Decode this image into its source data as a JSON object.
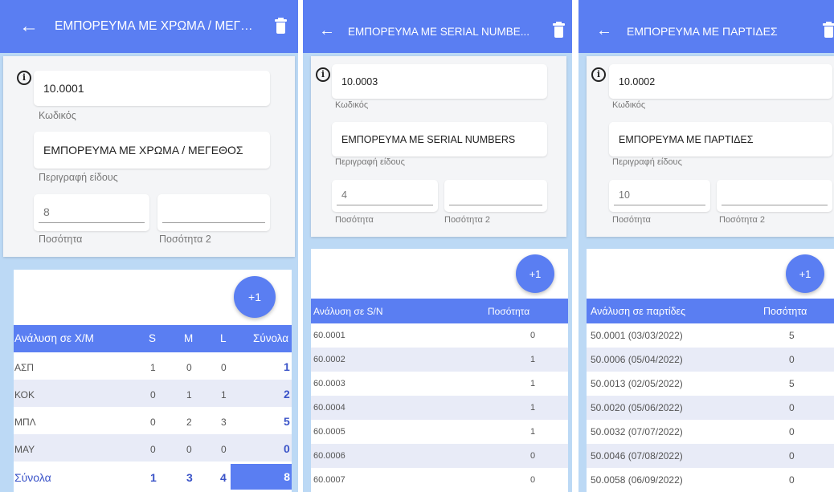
{
  "theme": {
    "primary": "#5a7ef2",
    "background": "#bcd9f5",
    "card": "#f4f5f7",
    "total_text": "#3a53c8",
    "alt_row": "#e8ebf7"
  },
  "panels": [
    {
      "title": "ΕΜΠΟΡΕΥΜΑ ΜΕ ΧΡΩΜΑ / ΜΕΓΕ...",
      "code_value": "10.0001",
      "code_label": "Κωδικός",
      "description_value": "ΕΜΠΟΡΕΥΜΑ ΜΕ ΧΡΩΜΑ / ΜΕΓΕΘΟΣ",
      "description_label": "Περιγραφή είδους",
      "qty_value": "8",
      "qty_label": "Ποσότητα",
      "qty2_value": "",
      "qty2_label": "Ποσότητα 2",
      "fab_label": "+1",
      "columns": [
        "Ανάλυση σε Χ/Μ",
        "S",
        "M",
        "L",
        "Σύνολα"
      ],
      "rows": [
        [
          "ΑΣΠ",
          "1",
          "0",
          "0",
          "1"
        ],
        [
          "ΚΟΚ",
          "0",
          "1",
          "1",
          "2"
        ],
        [
          "ΜΠΛ",
          "0",
          "2",
          "3",
          "5"
        ],
        [
          "ΜΑΥ",
          "0",
          "0",
          "0",
          "0"
        ]
      ],
      "totals": [
        "Σύνολα",
        "1",
        "3",
        "4",
        "8"
      ]
    },
    {
      "title": "ΕΜΠΟΡΕΥΜΑ ΜΕ SERIAL NUMBE...",
      "code_value": "10.0003",
      "code_label": "Κωδικός",
      "description_value": "ΕΜΠΟΡΕΥΜΑ ΜΕ SERIAL NUMBERS",
      "description_label": "Περιγραφή είδους",
      "qty_value": "4",
      "qty_label": "Ποσότητα",
      "qty2_value": "",
      "qty2_label": "Ποσότητα 2",
      "fab_label": "+1",
      "columns": [
        "Ανάλυση σε S/N",
        "Ποσότητα"
      ],
      "rows": [
        [
          "60.0001",
          "0"
        ],
        [
          "60.0002",
          "1"
        ],
        [
          "60.0003",
          "1"
        ],
        [
          "60.0004",
          "1"
        ],
        [
          "60.0005",
          "1"
        ],
        [
          "60.0006",
          "0"
        ],
        [
          "60.0007",
          "0"
        ]
      ]
    },
    {
      "title": "ΕΜΠΟΡΕΥΜΑ ΜΕ ΠΑΡΤΙΔΕΣ",
      "code_value": "10.0002",
      "code_label": "Κωδικός",
      "description_value": "ΕΜΠΟΡΕΥΜΑ ΜΕ ΠΑΡΤΙΔΕΣ",
      "description_label": "Περιγραφή είδους",
      "qty_value": "10",
      "qty_label": "Ποσότητα",
      "qty2_value": "",
      "qty2_label": "Ποσότητα 2",
      "fab_label": "+1",
      "columns": [
        "Ανάλυση σε παρτίδες",
        "Ποσότητα"
      ],
      "rows": [
        [
          "50.0001 (03/03/2022)",
          "5"
        ],
        [
          "50.0006 (05/04/2022)",
          "0"
        ],
        [
          "50.0013 (02/05/2022)",
          "5"
        ],
        [
          "50.0020 (05/06/2022)",
          "0"
        ],
        [
          "50.0032 (07/07/2022)",
          "0"
        ],
        [
          "50.0046 (07/08/2022)",
          "0"
        ],
        [
          "50.0058 (06/09/2022)",
          "0"
        ]
      ]
    }
  ]
}
